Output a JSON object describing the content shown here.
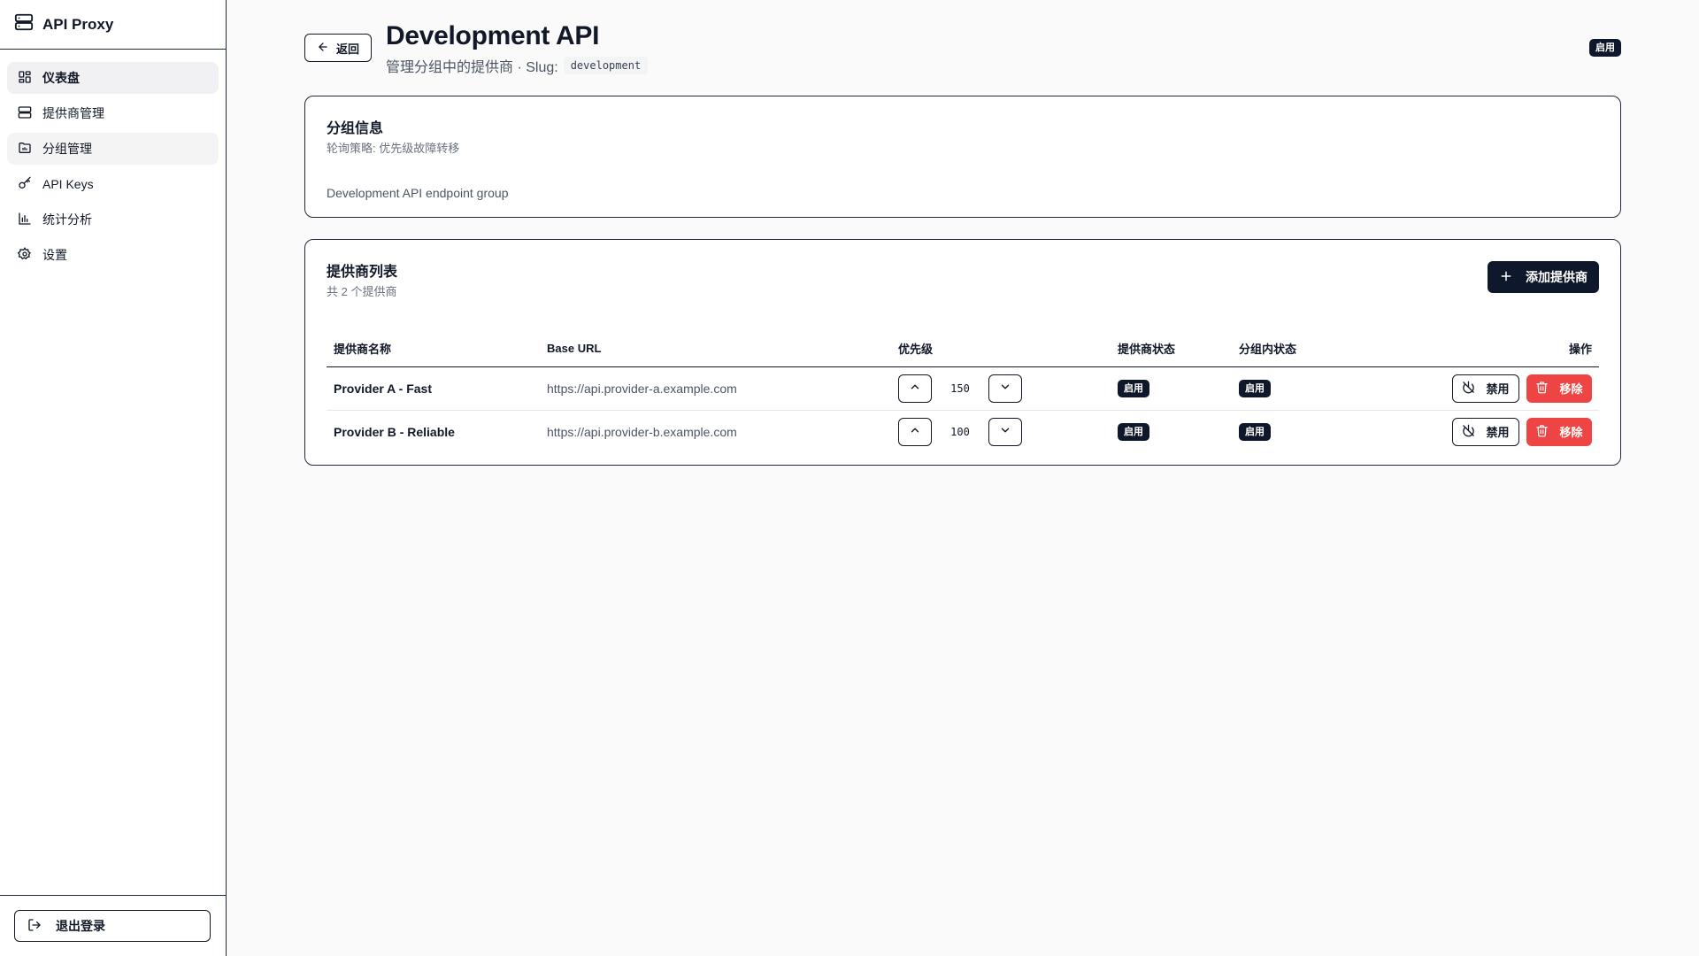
{
  "app": {
    "name": "API Proxy"
  },
  "sidebar": {
    "items": [
      {
        "label": "仪表盘",
        "icon": "dashboard-icon"
      },
      {
        "label": "提供商管理",
        "icon": "server-icon"
      },
      {
        "label": "分组管理",
        "icon": "folder-icon"
      },
      {
        "label": "API Keys",
        "icon": "key-icon"
      },
      {
        "label": "统计分析",
        "icon": "bar-chart-icon"
      },
      {
        "label": "设置",
        "icon": "gear-icon"
      }
    ],
    "logout_label": "退出登录"
  },
  "header": {
    "back_label": "返回",
    "title": "Development API",
    "subtitle": "管理分组中的提供商 · Slug:",
    "slug": "development",
    "status": "启用"
  },
  "group_info": {
    "title": "分组信息",
    "strategy": "轮询策略: 优先级故障转移",
    "description": "Development API endpoint group"
  },
  "providers": {
    "title": "提供商列表",
    "count_text": "共 2 个提供商",
    "add_label": "添加提供商",
    "columns": {
      "name": "提供商名称",
      "url": "Base URL",
      "priority": "优先级",
      "status": "提供商状态",
      "group_status": "分组内状态",
      "actions": "操作"
    },
    "rows": [
      {
        "name": "Provider A - Fast",
        "url": "https://api.provider-a.example.com",
        "priority": "150",
        "status": "启用",
        "group_status": "启用",
        "disable_label": "禁用",
        "remove_label": "移除"
      },
      {
        "name": "Provider B - Reliable",
        "url": "https://api.provider-b.example.com",
        "priority": "100",
        "status": "启用",
        "group_status": "启用",
        "disable_label": "禁用",
        "remove_label": "移除"
      }
    ]
  },
  "colors": {
    "primary": "#0f172a",
    "danger": "#ef4444",
    "background": "#fafafa"
  }
}
